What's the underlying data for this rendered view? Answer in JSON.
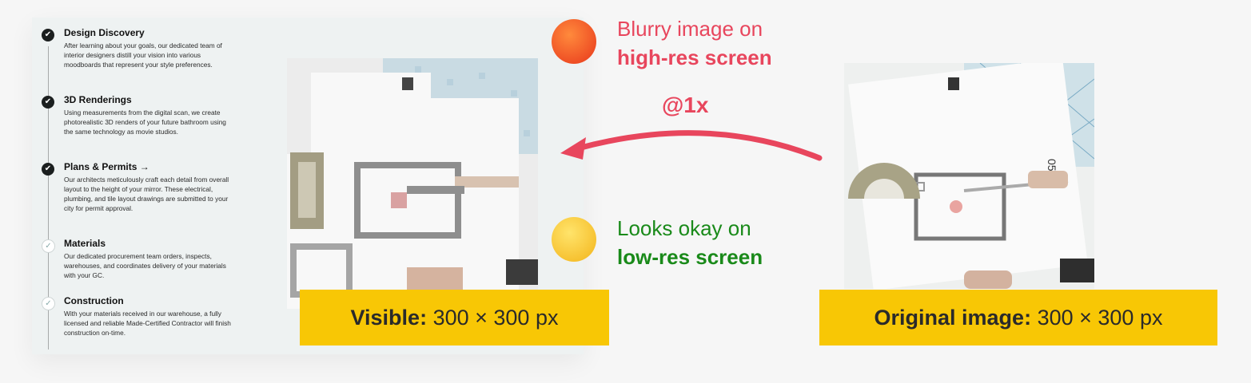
{
  "steps": [
    {
      "title": "Design Discovery",
      "desc": "After learning about your goals, our dedicated team of interior designers distill your vision into various moodboards that represent your style preferences."
    },
    {
      "title": "3D Renderings",
      "desc": "Using measurements from the digital scan, we create photorealistic 3D renders of your future bathroom using the same technology as movie studios."
    },
    {
      "title": "Plans & Permits →",
      "desc": "Our architects meticulously craft each detail from overall layout to the height of your mirror. These electrical, plumbing, and tile layout drawings are submitted to your city for permit approval."
    },
    {
      "title": "Materials",
      "desc": "Our dedicated procurement team orders, inspects, warehouses, and coordinates delivery of your materials with your GC."
    },
    {
      "title": "Construction",
      "desc": "With your materials received in our warehouse, a fully licensed and reliable Made-Certified Contractor will finish construction on-time."
    }
  ],
  "captions": {
    "blurry_line1": "Blurry image on",
    "blurry_line2": "high-res screen",
    "ok_line1": "Looks okay on",
    "ok_line2": "low-res screen",
    "scale": "@1x"
  },
  "labels": {
    "visible_bold": "Visible:",
    "visible_value": "300 × 300 px",
    "original_bold": "Original image:",
    "original_value": "300 × 300 px"
  },
  "colors": {
    "red": "#e8465d",
    "green": "#1a8a1a",
    "yellow": "#f8c705"
  },
  "icons": [
    "check-icon",
    "angry-face-icon",
    "smiling-face-icon",
    "arrow-left-icon"
  ]
}
